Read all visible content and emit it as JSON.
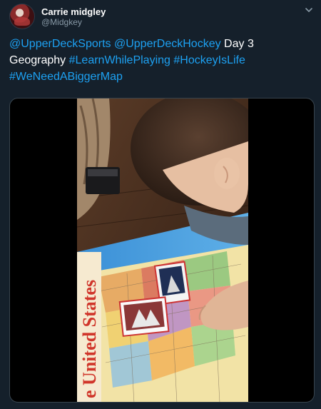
{
  "author": {
    "display_name": "Carrie midgley",
    "handle": "@Midgkey"
  },
  "tweet": {
    "mention_1": "@UpperDeckSports",
    "mention_2": "@UpperDeckHockey",
    "text_1": "Day 3",
    "text_2": "Geography",
    "hashtag_1": "#LearnWhilePlaying",
    "hashtag_2": "#HockeyIsLife",
    "hashtag_3": "#WeNeedABiggerMap"
  },
  "media": {
    "map_title": "e United States"
  },
  "icons": {
    "caret": "chevron-down-icon"
  },
  "colors": {
    "background": "#15202b",
    "link": "#1da1f2",
    "secondary_text": "#8899a6"
  }
}
